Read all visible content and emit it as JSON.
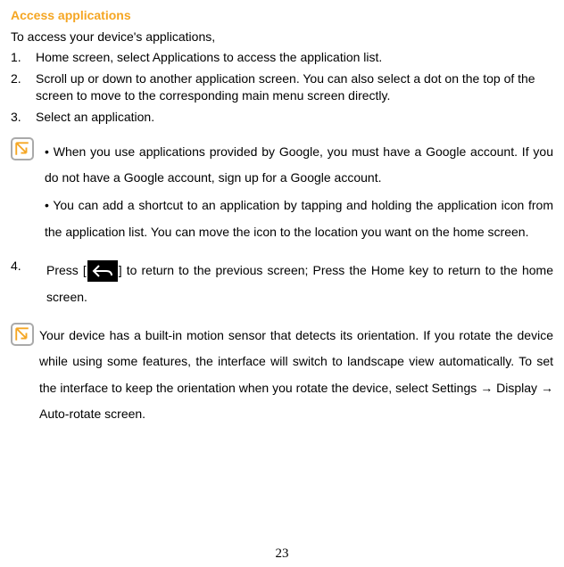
{
  "heading": "Access applications",
  "intro": "To access your device's applications,",
  "steps": {
    "s1": "Home screen, select Applications to access the application list.",
    "s2": "Scroll up or down to another application screen. You can also select a dot on the top of the screen to move to the corresponding main menu screen directly.",
    "s3": "Select an application."
  },
  "note1": {
    "b1": "• When you use applications provided by Google, you must have a Google account. If you do not have a Google account, sign up for a Google account.",
    "b2": "• You can add a shortcut to an application by tapping and holding the application icon from the application list. You can move the icon to the location you want on the home screen."
  },
  "step4": {
    "pre": "Press [",
    "post": "] to return to the previous screen; Press the Home key to return to the home screen."
  },
  "note2": "Your device has a built-in motion sensor that detects its orientation. If you rotate the device while using some features, the interface will switch to landscape view automatically. To set the interface to keep the orientation when you rotate the device, select Settings → Display → Auto-rotate screen.",
  "pageNumber": "23"
}
